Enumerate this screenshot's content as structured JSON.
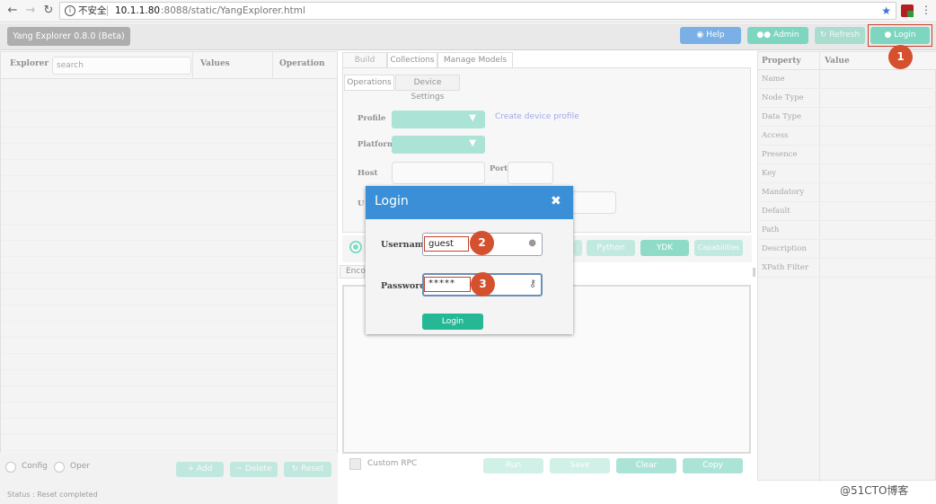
{
  "browser": {
    "insecure_label": "不安全",
    "url_host": "10.1.1.80",
    "url_rest": ":8088/static/YangExplorer.html"
  },
  "header": {
    "app_title": "Yang Explorer 0.8.0 (Beta)",
    "help_label": "Help",
    "admin_label": "Admin",
    "refresh_label": "Refresh",
    "login_label": "Login"
  },
  "explorer": {
    "col_explorer": "Explorer",
    "search_placeholder": "search",
    "col_values": "Values",
    "col_operation": "Operation",
    "config_label": "Config",
    "oper_label": "Oper",
    "add_label": "Add",
    "delete_label": "Delete",
    "reset_label": "Reset",
    "status": "Status : Reset completed"
  },
  "center": {
    "tabs": [
      "Build",
      "Collections",
      "Manage Models"
    ],
    "subtabs": [
      "Operations",
      "Device Settings"
    ],
    "profile_label": "Profile",
    "create_profile_link": "Create device profile",
    "platform_label": "Platform",
    "host_label": "Host",
    "port_label": "Port",
    "user_label_partial": "U",
    "enc_tab_partial": "Enco",
    "python_label": "Python",
    "ydk_label": "YDK",
    "capabilities_label": "Capabilities",
    "custom_rpc_label": "Custom RPC",
    "run_label": "Run",
    "save_label": "Save",
    "clear_label": "Clear",
    "copy_label": "Copy"
  },
  "properties": {
    "col_property": "Property",
    "col_value": "Value",
    "items": [
      "Name",
      "Node Type",
      "Data Type",
      "Access",
      "Presence",
      "Key",
      "Mandatory",
      "Default",
      "Path",
      "Description",
      "XPath Filter"
    ]
  },
  "login_modal": {
    "title": "Login",
    "username_label": "Username:",
    "username_value": "guest",
    "password_label": "Password:",
    "password_value": "*****",
    "submit_label": "Login"
  },
  "annotations": {
    "step1": "1",
    "step2": "2",
    "step3": "3",
    "watermark": "@51CTO博客"
  },
  "colors": {
    "teal": "#7ed6c0",
    "teal_dark": "#2fbf9f",
    "modal_header": "#3a8fd6",
    "annotation_red": "#d4502f"
  }
}
